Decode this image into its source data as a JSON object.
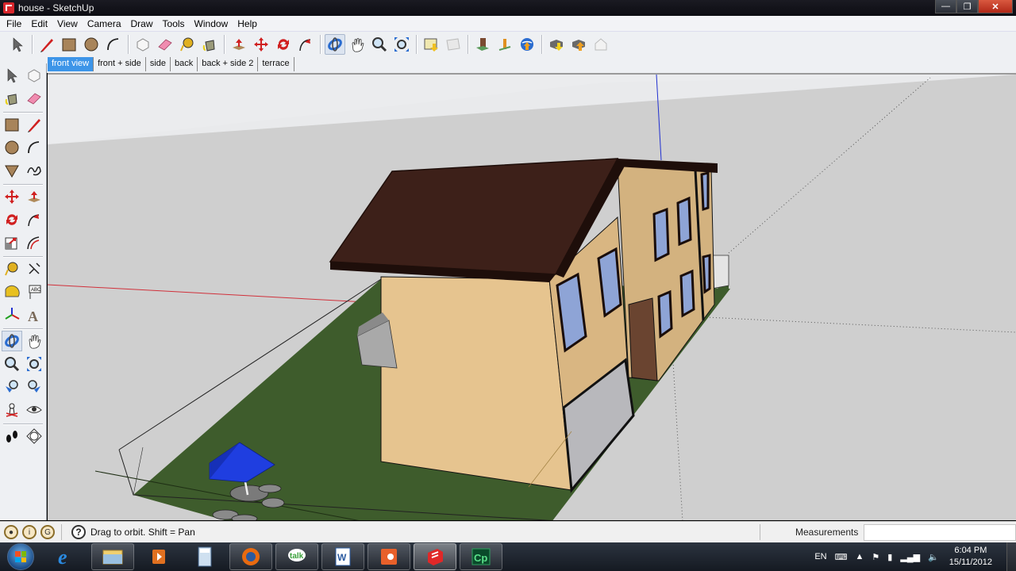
{
  "window": {
    "title": "house - SketchUp",
    "controls": {
      "minimize": "—",
      "maximize": "❐",
      "close": "✕"
    }
  },
  "menu": [
    "File",
    "Edit",
    "View",
    "Camera",
    "Draw",
    "Tools",
    "Window",
    "Help"
  ],
  "toolbar_top": {
    "groups": [
      [
        "select-icon"
      ],
      [
        "pencil-line-icon",
        "rectangle-icon",
        "circle-icon",
        "arc-icon"
      ],
      [
        "make-component-icon",
        "eraser-icon",
        "tape-measure-icon",
        "paint-bucket-icon"
      ],
      [
        "push-pull-icon",
        "move-icon",
        "rotate-icon",
        "follow-me-icon"
      ],
      [
        "orbit-icon",
        "pan-icon",
        "zoom-icon",
        "zoom-extents-icon"
      ],
      [
        "get-current-view-icon",
        "toggle-terrain-icon"
      ],
      [
        "add-building-icon",
        "add-location-icon",
        "preview-google-earth-icon"
      ],
      [
        "get-models-icon",
        "share-model-icon",
        "share-component-icon"
      ]
    ],
    "active_tool": "orbit-icon"
  },
  "scene_tabs": [
    {
      "label": "front view",
      "selected": true
    },
    {
      "label": "front + side",
      "selected": false
    },
    {
      "label": "side",
      "selected": false
    },
    {
      "label": "back",
      "selected": false
    },
    {
      "label": "back + side 2",
      "selected": false
    },
    {
      "label": "terrace",
      "selected": false
    }
  ],
  "toolbar_left": [
    [
      "select-icon",
      "make-component-icon"
    ],
    [
      "paint-bucket-icon",
      "eraser-icon"
    ],
    [
      "rectangle-icon",
      "pencil-line-icon"
    ],
    [
      "circle-icon",
      "arc-icon"
    ],
    [
      "polygon-icon",
      "freehand-icon"
    ],
    [
      "move-icon",
      "push-pull-icon"
    ],
    [
      "rotate-icon",
      "follow-me-icon"
    ],
    [
      "scale-icon",
      "offset-icon"
    ],
    [
      "tape-measure-icon",
      "dimensions-icon"
    ],
    [
      "protractor-icon",
      "text-icon"
    ],
    [
      "axes-icon",
      "3d-text-icon"
    ],
    [
      "orbit-icon",
      "pan-icon"
    ],
    [
      "zoom-icon",
      "zoom-extents-icon"
    ],
    [
      "previous-view-icon",
      "next-view-icon"
    ],
    [
      "position-camera-icon",
      "look-around-icon"
    ],
    [
      "walk-icon",
      "section-plane-icon"
    ]
  ],
  "viewport": {
    "colors": {
      "sky": "#e9eaec",
      "ground": "#cfcfcf",
      "grass": "#3e5c2c",
      "wall": "#e6c48f",
      "wall_shadow": "#c9a877",
      "roof": "#3d2019",
      "roof_edge": "#1e0e0a",
      "garage_door": "#b8b8bc",
      "door_brown": "#6a4430",
      "window_glass": "#8ea4d6",
      "umbrella": "#1f3ee0",
      "axis_red": "#d0303a",
      "axis_blue": "#2030d0"
    }
  },
  "status": {
    "hint": "Drag to orbit.  Shift = Pan",
    "measurements_label": "Measurements",
    "measurements_value": ""
  },
  "taskbar": {
    "apps": [
      {
        "name": "internet-explorer-icon",
        "open": false
      },
      {
        "name": "file-explorer-icon",
        "open": true
      },
      {
        "name": "media-player-icon",
        "open": false
      },
      {
        "name": "calculator-icon",
        "open": false
      },
      {
        "name": "firefox-icon",
        "open": true
      },
      {
        "name": "google-talk-icon",
        "open": true
      },
      {
        "name": "word-icon",
        "open": true
      },
      {
        "name": "powerpoint-icon",
        "open": true
      },
      {
        "name": "sketchup-icon",
        "open": true,
        "current": true
      },
      {
        "name": "captivate-icon",
        "open": true
      }
    ],
    "tray": {
      "language": "EN",
      "time": "6:04 PM",
      "date": "15/11/2012"
    }
  }
}
